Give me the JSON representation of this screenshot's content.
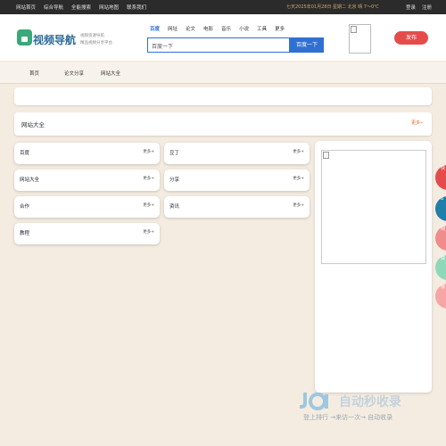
{
  "topbar": {
    "nav": [
      "网站首页",
      "综合导航",
      "全能搜索",
      "网站地图",
      "联系我们"
    ],
    "info": "七天2025年01月28日 星期二 北京 晴 7～0℃",
    "login": "登录",
    "register": "注册"
  },
  "header": {
    "logo_text": "视频导航",
    "slogan_line1": "视频资源导航",
    "slogan_line2": "精品视频分享平台",
    "search_tabs": [
      "百度",
      "网址",
      "论文",
      "电影",
      "音乐",
      "小说",
      "工具",
      "更多"
    ],
    "search_placeholder": "百度一下",
    "search_button": "百度一下",
    "publish_button": "发布"
  },
  "subnav": [
    "首页",
    "论文分享",
    "网站大全"
  ],
  "section": {
    "title": "网站大全",
    "more": "更多»"
  },
  "categories": [
    {
      "name": "百度",
      "more": "更多+"
    },
    {
      "name": "豆丁",
      "more": "更多+"
    },
    {
      "name": "网站大全",
      "more": "更多+"
    },
    {
      "name": "分享",
      "more": "更多+"
    },
    {
      "name": "合作",
      "more": "更多+"
    },
    {
      "name": "资讯",
      "more": "更多+"
    },
    {
      "name": "教程",
      "more": "更多+"
    }
  ],
  "float_buttons": [
    {
      "label": "快",
      "color": "#e64b4b"
    },
    {
      "label": "",
      "color": "#1f7fa8"
    },
    {
      "label": "网",
      "color": "#f08c8c"
    },
    {
      "label": "快",
      "color": "#8ed8b9"
    },
    {
      "label": "我",
      "color": "#f7a6a6"
    }
  ],
  "watermark": {
    "text": "自动秒收录",
    "sub": "登上排行 →来访一次→ 自动收录"
  }
}
